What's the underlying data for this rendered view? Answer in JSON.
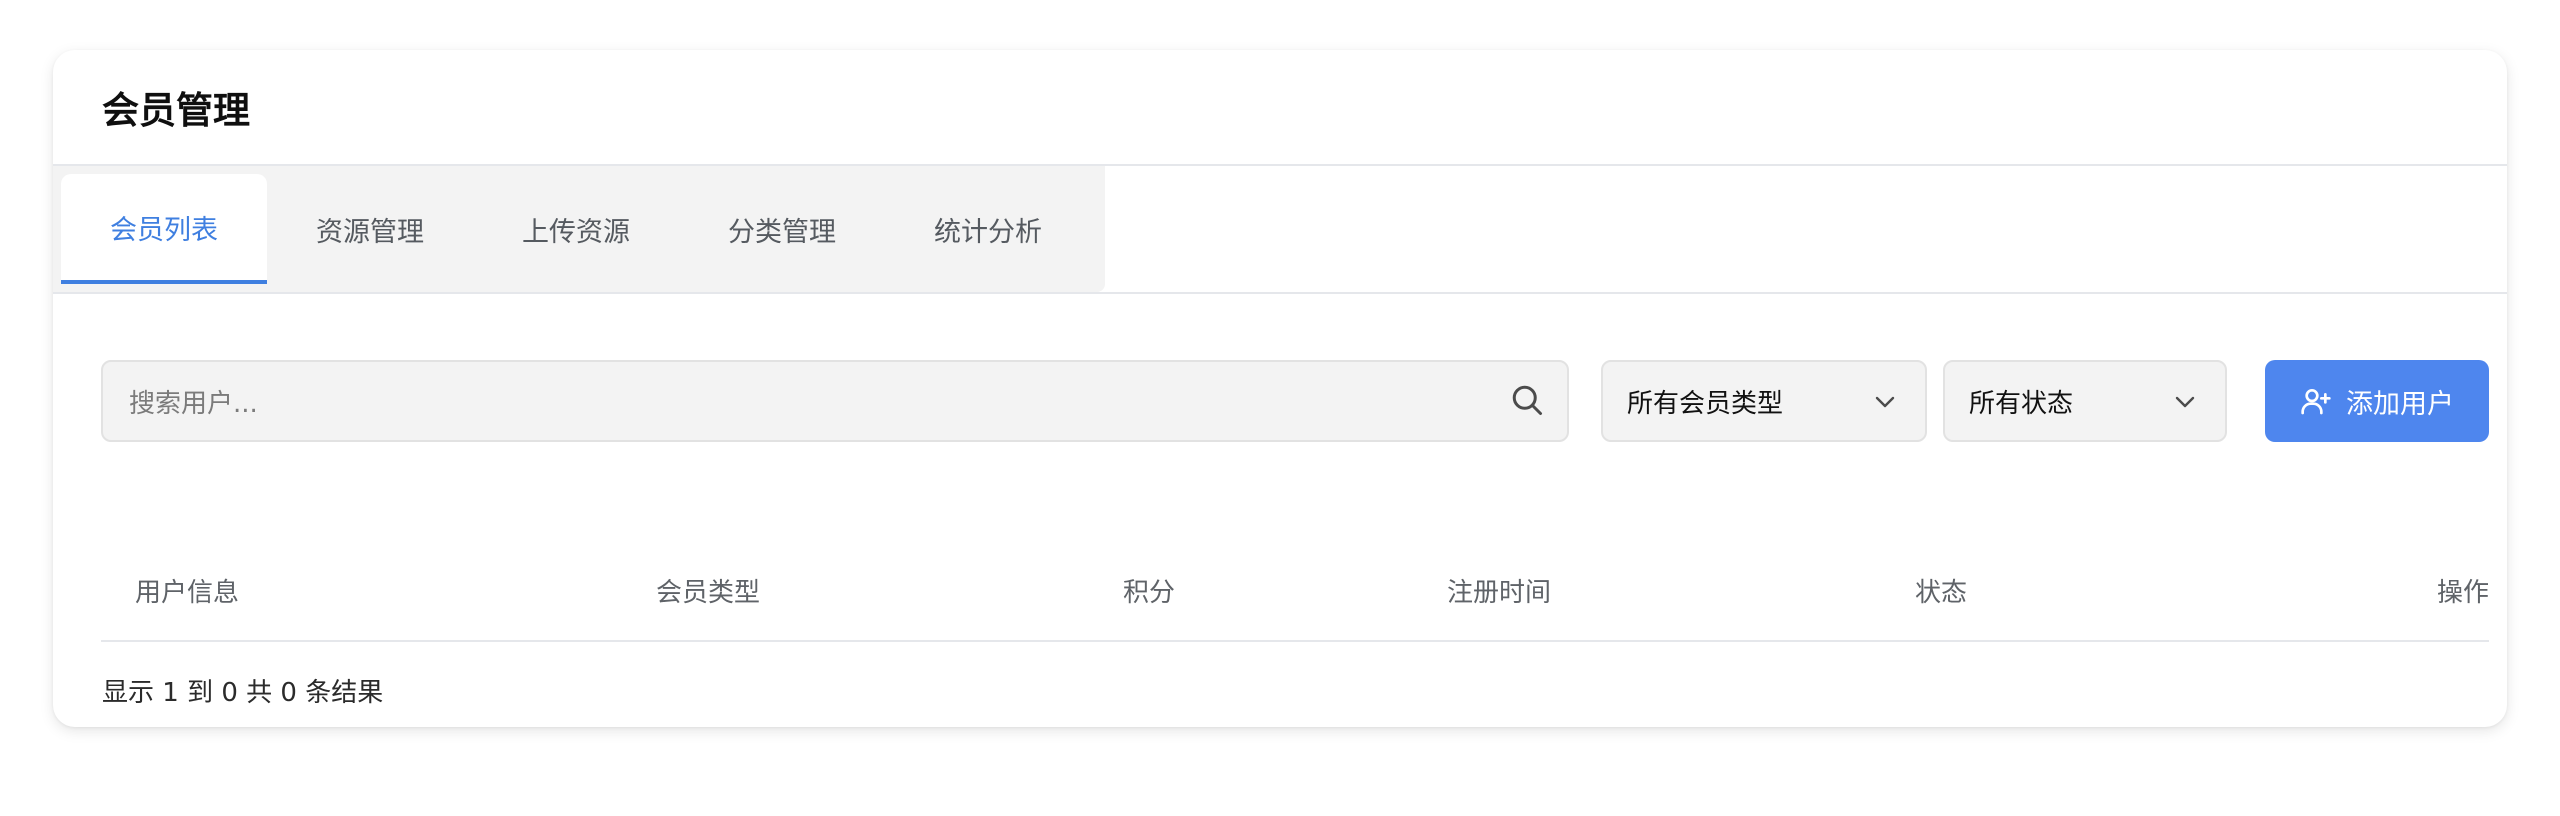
{
  "page": {
    "title": "会员管理"
  },
  "tabs": [
    {
      "label": "会员列表",
      "active": true
    },
    {
      "label": "资源管理",
      "active": false
    },
    {
      "label": "上传资源",
      "active": false
    },
    {
      "label": "分类管理",
      "active": false
    },
    {
      "label": "统计分析",
      "active": false
    }
  ],
  "toolbar": {
    "search_placeholder": "搜索用户...",
    "member_type_select": "所有会员类型",
    "status_select": "所有状态",
    "add_button_label": "添加用户"
  },
  "table": {
    "columns": [
      "用户信息",
      "会员类型",
      "积分",
      "注册时间",
      "状态",
      "操作"
    ],
    "rows": []
  },
  "footer": {
    "result_text": "显示 1 到 0 共 0 条结果"
  },
  "colors": {
    "accent": "#3f7fe0",
    "button_bg": "#4e86ee",
    "tab_bg": "#f3f3f3"
  },
  "icons": {
    "search": "search-icon",
    "dropdown": "chevron-down-icon",
    "add_user": "user-plus-icon"
  }
}
